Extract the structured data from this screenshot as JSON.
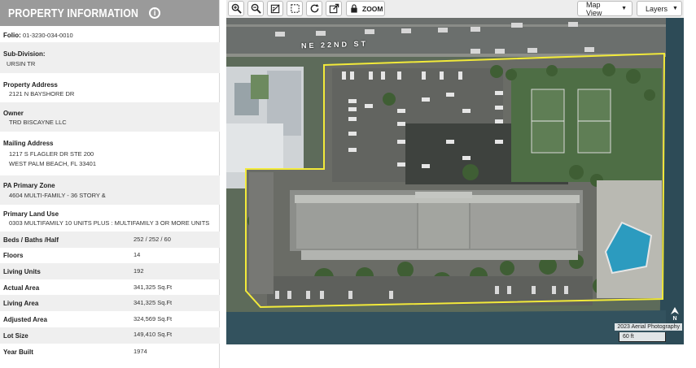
{
  "panel": {
    "title": "PROPERTY INFORMATION",
    "folio_label": "Folio:",
    "folio_value": "01-3230-034-0010",
    "subdivision_label": "Sub-Division:",
    "subdivision_value": "URSIN TR",
    "address_label": "Property Address",
    "address_value": "2121 N BAYSHORE DR",
    "owner_label": "Owner",
    "owner_value": "TRD BISCAYNE LLC",
    "mailing_label": "Mailing Address",
    "mailing_line1": "1217 S FLAGLER DR STE 200",
    "mailing_line2": "WEST PALM BEACH, FL 33401",
    "zone_label": "PA Primary Zone",
    "zone_value": "4604 MULTI-FAMILY - 36 STORY &",
    "landuse_label": "Primary Land Use",
    "landuse_value": "0303 MULTIFAMILY 10 UNITS PLUS : MULTIFAMILY 3 OR MORE UNITS",
    "stats": [
      {
        "label": "Beds / Baths /Half",
        "value": "252 / 252 / 60"
      },
      {
        "label": "Floors",
        "value": "14"
      },
      {
        "label": "Living Units",
        "value": "192"
      },
      {
        "label": "Actual Area",
        "value": "341,325 Sq.Ft"
      },
      {
        "label": "Living Area",
        "value": "341,325 Sq.Ft"
      },
      {
        "label": "Adjusted Area",
        "value": "324,569 Sq.Ft"
      },
      {
        "label": "Lot Size",
        "value": "149,410 Sq.Ft"
      },
      {
        "label": "Year Built",
        "value": "1974"
      }
    ]
  },
  "toolbar": {
    "zoom_label": "ZOOM",
    "map_view_label": "Map View",
    "layers_label": "Layers"
  },
  "map": {
    "street_label": "NE 22ND ST",
    "attribution": "2023 Aerial Photography",
    "scale_label": "60 ft",
    "north_label": "N",
    "parcel_color": "#f2ea3a"
  }
}
